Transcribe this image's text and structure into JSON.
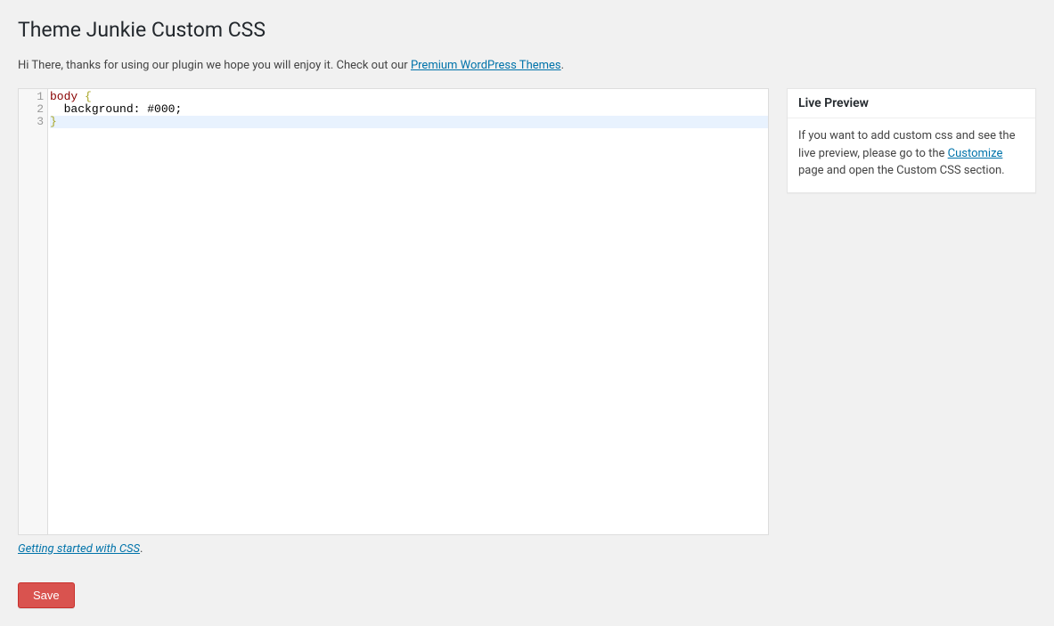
{
  "header": {
    "title": "Theme Junkie Custom CSS"
  },
  "intro": {
    "prefix": "Hi There, thanks for using our plugin we hope you will enjoy it. Check out our ",
    "link_text": "Premium WordPress Themes",
    "suffix": "."
  },
  "editor": {
    "line_numbers": [
      "1",
      "2",
      "3"
    ],
    "lines": [
      {
        "type": "open",
        "selector": "body",
        "brace": "{"
      },
      {
        "type": "decl",
        "indent": "  ",
        "prop": "background",
        "colon": ": ",
        "value": "#000",
        "semi": ";"
      },
      {
        "type": "close",
        "brace": "}"
      }
    ]
  },
  "below_editor": {
    "link_text": "Getting started with CSS",
    "suffix": "."
  },
  "actions": {
    "save_label": "Save"
  },
  "sidebar": {
    "live_preview": {
      "title": "Live Preview",
      "text_before": "If you want to add custom css and see the live preview, please go to the ",
      "link_text": "Customize",
      "text_after": " page and open the Custom CSS section."
    }
  }
}
